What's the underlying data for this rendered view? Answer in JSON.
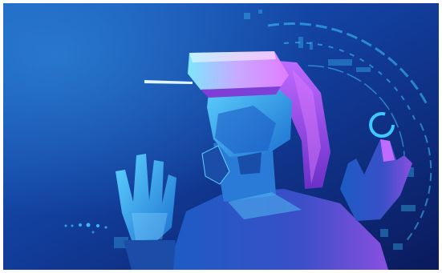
{
  "image": {
    "subject": "vr-headset-user-illustration",
    "colors": {
      "background_dark": "#0a1a5c",
      "background_mid": "#1546a8",
      "background_light": "#2f86d8",
      "cyan_accent": "#3fc8ff",
      "magenta_accent": "#e07cff",
      "purple": "#7d3fd6",
      "headset_light": "#d6b8ff"
    },
    "icons": [
      "vr-headset-icon",
      "hud-ring-icon",
      "hand-icon"
    ]
  }
}
